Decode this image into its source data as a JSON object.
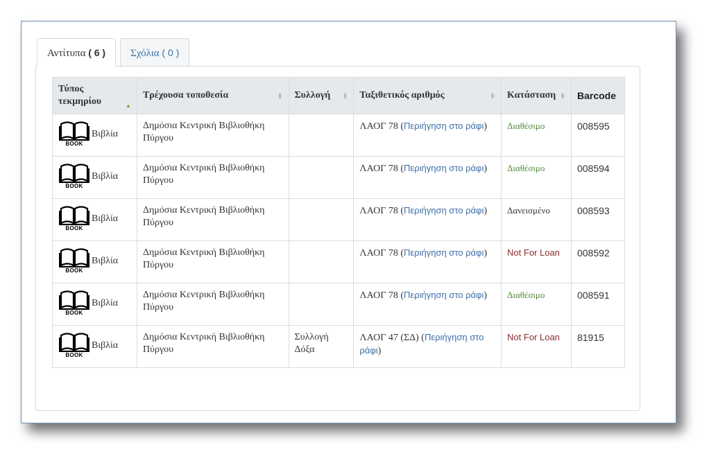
{
  "tabs": [
    {
      "label": "Αντίτυπα",
      "count": "( 6 )"
    },
    {
      "label": "Σχόλια",
      "count": "( 0 )"
    }
  ],
  "table": {
    "headers": {
      "type": "Τύπος τεκμηρίου",
      "location": "Τρέχουσα τοποθεσία",
      "collection": "Συλλογή",
      "callnumber": "Ταξιθετικός αριθμός",
      "status": "Κατάσταση",
      "barcode": "Barcode"
    },
    "rows": [
      {
        "type": "Βιβλία",
        "icon_caption": "BOOK",
        "location": "Δημόσια Κεντρική Βιβλιοθήκη Πύργου",
        "collection": "",
        "callnumber": "ΛΑΟΓ 78",
        "shelf_link": "Περιήγηση στο ράφι",
        "status": "Διαθέσιμο",
        "barcode": "008595"
      },
      {
        "type": "Βιβλία",
        "icon_caption": "BOOK",
        "location": "Δημόσια Κεντρική Βιβλιοθήκη Πύργου",
        "collection": "",
        "callnumber": "ΛΑΟΓ 78",
        "shelf_link": "Περιήγηση στο ράφι",
        "status": "Διαθέσιμο",
        "barcode": "008594"
      },
      {
        "type": "Βιβλία",
        "icon_caption": "BOOK",
        "location": "Δημόσια Κεντρική Βιβλιοθήκη Πύργου",
        "collection": "",
        "callnumber": "ΛΑΟΓ 78",
        "shelf_link": "Περιήγηση στο ράφι",
        "status": "Δανεισμένο",
        "barcode": "008593"
      },
      {
        "type": "Βιβλία",
        "icon_caption": "BOOK",
        "location": "Δημόσια Κεντρική Βιβλιοθήκη Πύργου",
        "collection": "",
        "callnumber": "ΛΑΟΓ 78",
        "shelf_link": "Περιήγηση στο ράφι",
        "status": "Not For Loan",
        "barcode": "008592"
      },
      {
        "type": "Βιβλία",
        "icon_caption": "BOOK",
        "location": "Δημόσια Κεντρική Βιβλιοθήκη Πύργου",
        "collection": "",
        "callnumber": "ΛΑΟΓ 78",
        "shelf_link": "Περιήγηση στο ράφι",
        "status": "Διαθέσιμο",
        "barcode": "008591"
      },
      {
        "type": "Βιβλία",
        "icon_caption": "BOOK",
        "location": "Δημόσια Κεντρική Βιβλιοθήκη Πύργου",
        "collection": "Συλλογή Δόξα",
        "callnumber": "ΛΑΟΓ 47 (ΣΔ)",
        "shelf_link": "Περιήγηση στο ράφι",
        "status": "Not For Loan",
        "barcode": "81915"
      }
    ]
  },
  "colors": {
    "frame_border": "#6f8fb3",
    "link": "#3d6fa8",
    "available": "#4e8a3a",
    "not_for_loan": "#8b2d2d",
    "header_bg": "#e5e9ec"
  }
}
